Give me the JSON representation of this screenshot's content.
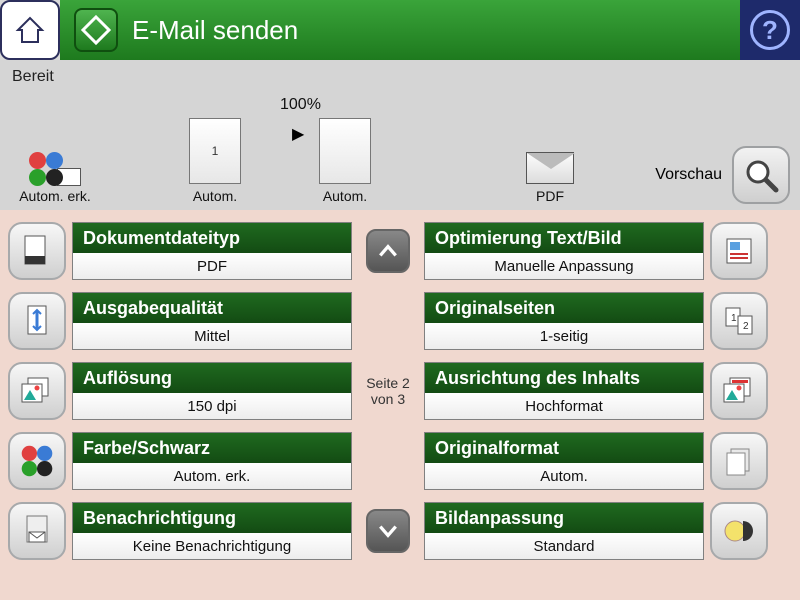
{
  "topbar": {
    "title": "E-Mail senden"
  },
  "status": "Bereit",
  "summary": {
    "color_label": "Autom. erk.",
    "input_page_num": "1",
    "input_label": "Autom.",
    "scale": "100%",
    "output_label": "Autom.",
    "format_label": "PDF",
    "preview_label": "Vorschau"
  },
  "pager": {
    "line1": "Seite 2",
    "line2": "von 3"
  },
  "left": [
    {
      "title": "Dokumentdateityp",
      "value": "PDF"
    },
    {
      "title": "Ausgabequalität",
      "value": "Mittel"
    },
    {
      "title": "Auflösung",
      "value": "150 dpi"
    },
    {
      "title": "Farbe/Schwarz",
      "value": "Autom. erk."
    },
    {
      "title": "Benachrichtigung",
      "value": "Keine Benachrichtigung"
    }
  ],
  "right": [
    {
      "title": "Optimierung Text/Bild",
      "value": "Manuelle Anpassung"
    },
    {
      "title": "Originalseiten",
      "value": "1-seitig"
    },
    {
      "title": "Ausrichtung des Inhalts",
      "value": "Hochformat"
    },
    {
      "title": "Originalformat",
      "value": "Autom."
    },
    {
      "title": "Bildanpassung",
      "value": "Standard"
    }
  ]
}
